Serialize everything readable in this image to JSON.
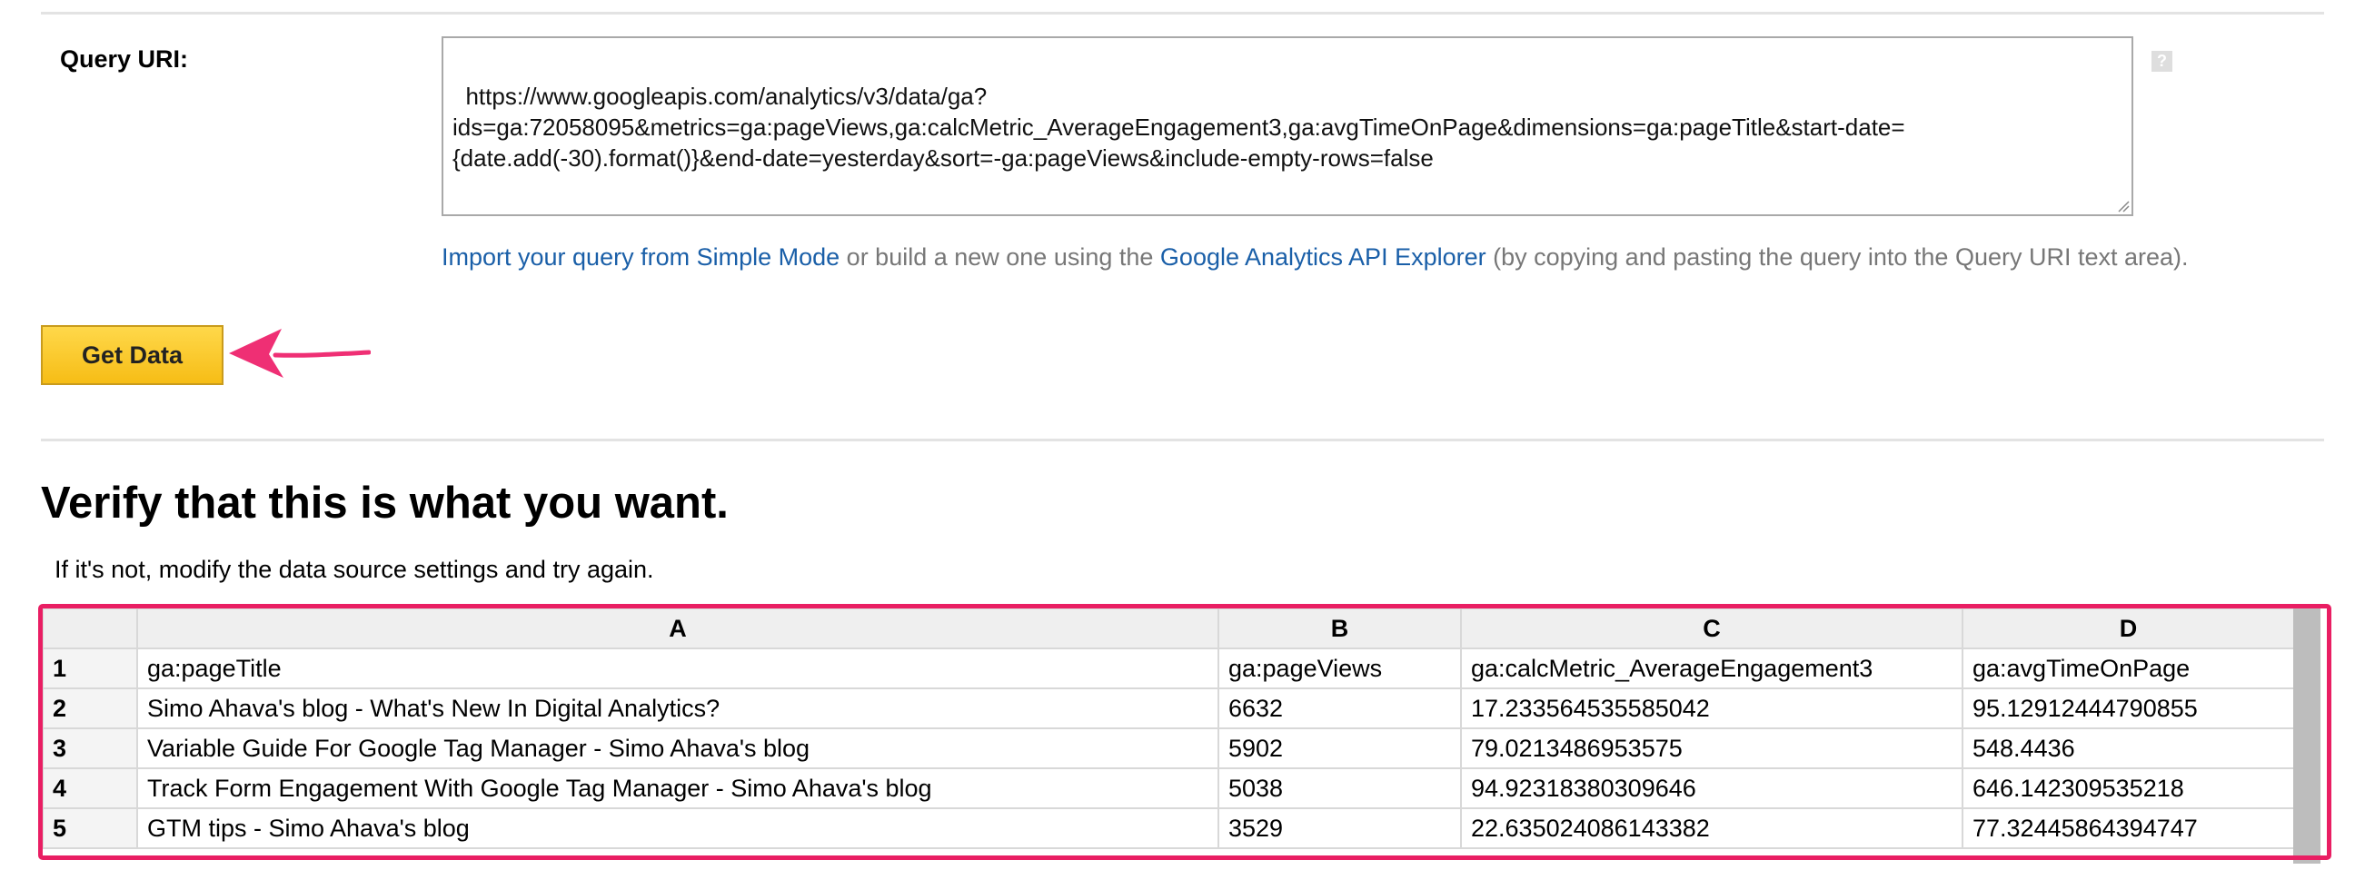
{
  "query": {
    "label": "Query URI:",
    "value": "https://www.googleapis.com/analytics/v3/data/ga?\nids=ga:72058095&metrics=ga:pageViews,ga:calcMetric_AverageEngagement3,ga:avgTimeOnPage&dimensions=ga:pageTitle&start-date=\n{date.add(-30).format()}&end-date=yesterday&sort=-ga:pageViews&include-empty-rows=false",
    "help_icon": "?",
    "help_text": {
      "link1": "Import your query from Simple Mode",
      "mid": " or build a new one using the ",
      "link2": "Google Analytics API Explorer",
      "tail": " (by copying and pasting the query into the Query URI text area)."
    }
  },
  "button": {
    "label": "Get Data"
  },
  "verify": {
    "title": "Verify that this is what you want.",
    "subtitle": "If it's not, modify the data source settings and try again."
  },
  "table": {
    "columns": [
      "A",
      "B",
      "C",
      "D"
    ],
    "rows": [
      {
        "num": "1",
        "cells": [
          "ga:pageTitle",
          "ga:pageViews",
          "ga:calcMetric_AverageEngagement3",
          "ga:avgTimeOnPage"
        ]
      },
      {
        "num": "2",
        "cells": [
          "Simo Ahava's blog - What's New In Digital Analytics?",
          "6632",
          "17.233564535585042",
          "95.12912444790855"
        ]
      },
      {
        "num": "3",
        "cells": [
          "Variable Guide For Google Tag Manager - Simo Ahava's blog",
          "5902",
          "79.0213486953575",
          "548.4436"
        ]
      },
      {
        "num": "4",
        "cells": [
          "Track Form Engagement With Google Tag Manager - Simo Ahava's blog",
          "5038",
          "94.92318380309646",
          "646.142309535218"
        ]
      },
      {
        "num": "5",
        "cells": [
          "GTM tips - Simo Ahava's blog",
          "3529",
          "22.635024086143382",
          "77.32445864394747"
        ]
      }
    ]
  },
  "colors": {
    "link": "#1a5fa8",
    "button": "#f6bd16",
    "highlight": "#e91e63"
  }
}
